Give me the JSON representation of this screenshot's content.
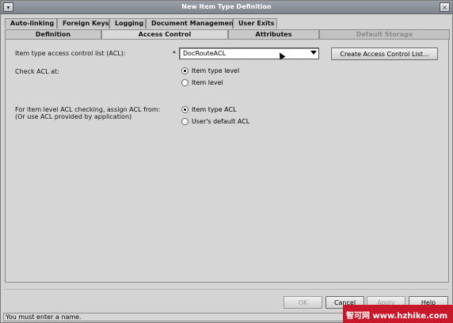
{
  "window": {
    "title": "New Item Type Definition"
  },
  "tabs_row1": [
    "Auto-linking",
    "Foreign Keys",
    "Logging",
    "Document Management",
    "User Exits"
  ],
  "tabs_row2": [
    {
      "label": "Definition",
      "state": "normal"
    },
    {
      "label": "Access Control",
      "state": "active"
    },
    {
      "label": "Attributes",
      "state": "normal"
    },
    {
      "label": "Default Storage",
      "state": "disabled"
    }
  ],
  "acl": {
    "label": "Item type access control list (ACL):",
    "required_mark": "*",
    "selected": "DocRouteACL",
    "create_button": "Create Access Control List..."
  },
  "check_acl": {
    "label": "Check ACL at:",
    "options": [
      "Item type level",
      "Item level"
    ],
    "selected_index": 0
  },
  "assign_acl": {
    "label_line1": "For item level ACL checking, assign ACL from:",
    "label_line2": "(Or use ACL provided by application)",
    "options": [
      "Item type ACL",
      "User's default ACL"
    ],
    "selected_index": 0
  },
  "footer": {
    "ok": "OK",
    "cancel": "Cancel",
    "apply": "Apply",
    "help": "Help",
    "status": "You must enter a name."
  },
  "watermark": {
    "text": "智可网 www.hzhike.com"
  },
  "colors": {
    "title_bg": "#8a9098",
    "watermark_bg": "#c8182a"
  },
  "icons": [
    "window-menu-icon",
    "close-icon",
    "dropdown-arrow-icon",
    "mouse-cursor-icon"
  ]
}
